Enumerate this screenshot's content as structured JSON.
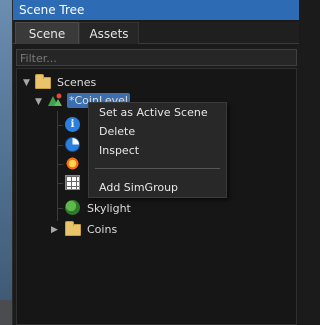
{
  "window": {
    "title": "Scene Tree"
  },
  "tabs": [
    {
      "label": "Scene",
      "active": true
    },
    {
      "label": "Assets",
      "active": false
    }
  ],
  "filter": {
    "placeholder": "Filter..."
  },
  "tree": {
    "root": {
      "label": "Scenes",
      "icon": "folder-icon"
    },
    "level": {
      "label": "*CoinLevel",
      "icon": "level-icon",
      "selected": true
    },
    "children": [
      {
        "label": "",
        "icon": "info-icon"
      },
      {
        "label": "",
        "icon": "pie-icon"
      },
      {
        "label": "",
        "icon": "sun-icon"
      },
      {
        "label": "",
        "icon": "grid-icon"
      },
      {
        "label": "Skylight",
        "icon": "skylight-icon"
      },
      {
        "label": "Coins",
        "icon": "folder-icon"
      }
    ]
  },
  "context_menu": {
    "items": [
      {
        "label": "Set as Active Scene"
      },
      {
        "label": "Delete"
      },
      {
        "label": "Inspect"
      },
      {
        "label": "Add SimGroup"
      }
    ]
  },
  "colors": {
    "titlebar": "#2d6cb5",
    "selection": "#3b6fb0",
    "folder": "#e9c46a",
    "panel_bg": "#1b1b1b"
  }
}
